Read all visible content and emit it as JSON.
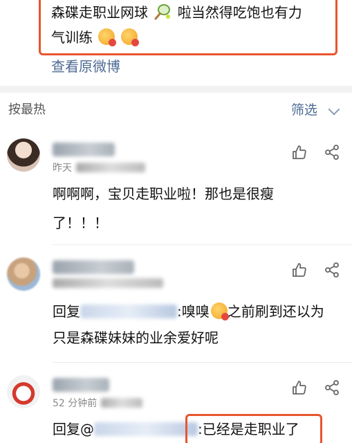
{
  "post": {
    "text_line1": "森碟走职业网球",
    "text_line1b": "啦当然得吃饱也有力",
    "text_line2": "气训练",
    "view_original": "查看原微博"
  },
  "sort_bar": {
    "sort_label": "按最热",
    "filter_label": "筛选"
  },
  "comments": [
    {
      "time": "昨天",
      "text_line1": "啊啊啊，宝贝走职业啦！那也是很瘦",
      "text_line2": "了！！！"
    },
    {
      "reply_prefix": "回复",
      "reply_colon": ":嗅嗅",
      "text_line1b": "之前刷到还以为",
      "text_line2": "只是森碟妹妹的业余爱好呢"
    },
    {
      "time": "52 分钟前",
      "reply_prefix": "回复@",
      "text_line1b": ":已经是走职业了"
    }
  ],
  "colors": {
    "accent_link": "#4d6a94",
    "highlight_box": "#e8552f",
    "band": "#f2f2f2"
  },
  "icons": [
    "tennis-racket-icon",
    "grinning-emoji-icon",
    "chevron-down-icon",
    "thumbs-up-icon",
    "share-icon"
  ]
}
